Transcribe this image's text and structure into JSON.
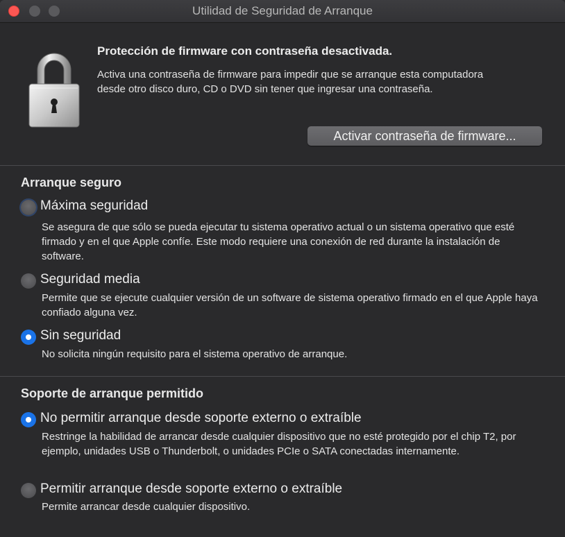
{
  "window": {
    "title": "Utilidad de Seguridad de Arranque"
  },
  "firmware": {
    "heading": "Protección de firmware con contraseña desactivada.",
    "description": "Activa una contraseña de firmware para impedir que se arranque esta computadora desde otro disco duro, CD o DVD sin tener que ingresar una contraseña.",
    "button_label": "Activar contraseña de firmware..."
  },
  "secure_boot": {
    "heading": "Arranque seguro",
    "options": [
      {
        "label": "Máxima seguridad",
        "description": "Se asegura de que sólo se pueda ejecutar tu sistema operativo actual o un sistema operativo que esté firmado y en el que Apple confíe. Este modo requiere una conexión de red durante la instalación de software.",
        "selected": false
      },
      {
        "label": "Seguridad media",
        "description": "Permite que se ejecute cualquier versión de un software de sistema operativo firmado en el que Apple haya confiado alguna vez.",
        "selected": false
      },
      {
        "label": "Sin seguridad",
        "description": "No solicita ningún requisito para el sistema operativo de arranque.",
        "selected": true
      }
    ]
  },
  "boot_media": {
    "heading": "Soporte de arranque permitido",
    "options": [
      {
        "label": "No permitir arranque desde soporte externo o extraíble",
        "description": "Restringe la habilidad de arrancar desde cualquier dispositivo que no esté protegido por el chip T2, por ejemplo, unidades USB o Thunderbolt, o unidades PCIe o SATA conectadas internamente.",
        "selected": true
      },
      {
        "label": "Permitir arranque desde soporte externo o extraíble",
        "description": "Permite arrancar desde cualquier dispositivo.",
        "selected": false
      }
    ]
  },
  "colors": {
    "accent": "#1a73e8",
    "close_button": "#fc5753",
    "background": "#2a2a2c"
  }
}
